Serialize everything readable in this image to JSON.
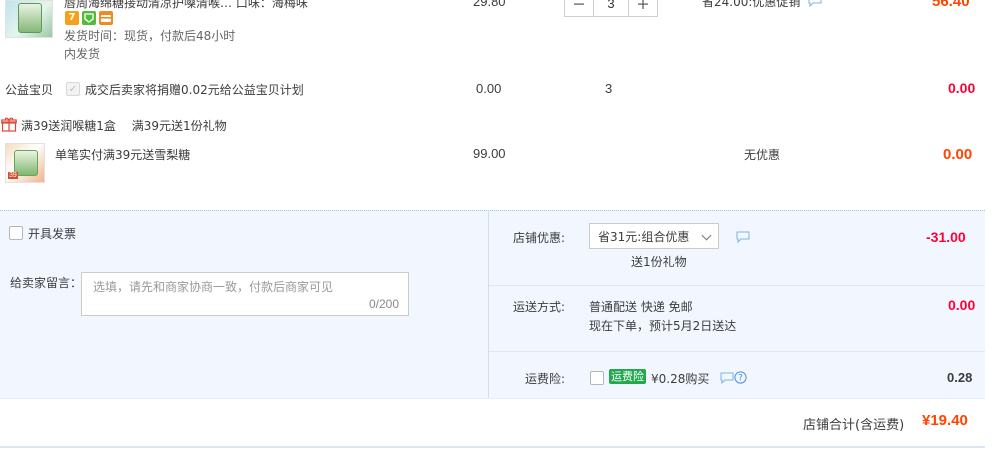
{
  "product1": {
    "title_fragment": "唇周海绵糖接动清凉护嗓清喉… 口味：海梅味",
    "price": "29.80",
    "quantity": "3",
    "discount_text": "省24.00:优惠促销",
    "total": "56.40",
    "ship_time": "发货时间：现货，付款后48小时",
    "ship_time2": "内发货",
    "badges": [
      {
        "icon": "seven-day-return-icon",
        "text": "7",
        "color": "#f4a21a"
      },
      {
        "icon": "guarantee-shield-icon",
        "text": "",
        "color": "#55b93e"
      },
      {
        "icon": "credit-card-icon",
        "text": "",
        "color": "#f08a24"
      }
    ]
  },
  "charity": {
    "label": "公益宝贝",
    "desc": "成交后卖家将捐赠0.02元给公益宝贝计划",
    "price": "0.00",
    "qty": "3",
    "total": "0.00"
  },
  "promo": {
    "header": "满39送润喉糖1盒　 满39元送1份礼物",
    "item_title": "单笔实付满39元送雪梨糖",
    "item_price": "99.00",
    "item_discount": "无优惠",
    "item_total": "0.00",
    "thumb_tag": "39"
  },
  "invoice": {
    "label": "开具发票"
  },
  "message": {
    "label": "给卖家留言：",
    "placeholder": "选填，请先和商家协商一致，付款后商家可见",
    "counter": "0/200"
  },
  "shop_discount": {
    "label": "店铺优惠:",
    "selected": "省31元:组合优惠",
    "gift_note": "送1份礼物",
    "amount": "-31.00"
  },
  "shipping": {
    "label": "运送方式:",
    "method": "普通配送 快递 免邮",
    "eta": "现在下单，预计5月2日送达",
    "amount": "0.00"
  },
  "insurance": {
    "label": "运费险:",
    "badge": "运费险",
    "price_text": "¥0.28购买",
    "amount": "0.28"
  },
  "summary": {
    "label": "店铺合计(含运费)",
    "amount": "¥19.40"
  },
  "colors": {
    "accent_red": "#ff0036",
    "accent_orange": "#ff4400",
    "panel_bg": "#f2f7ff",
    "insurance_green": "#22a84f"
  }
}
